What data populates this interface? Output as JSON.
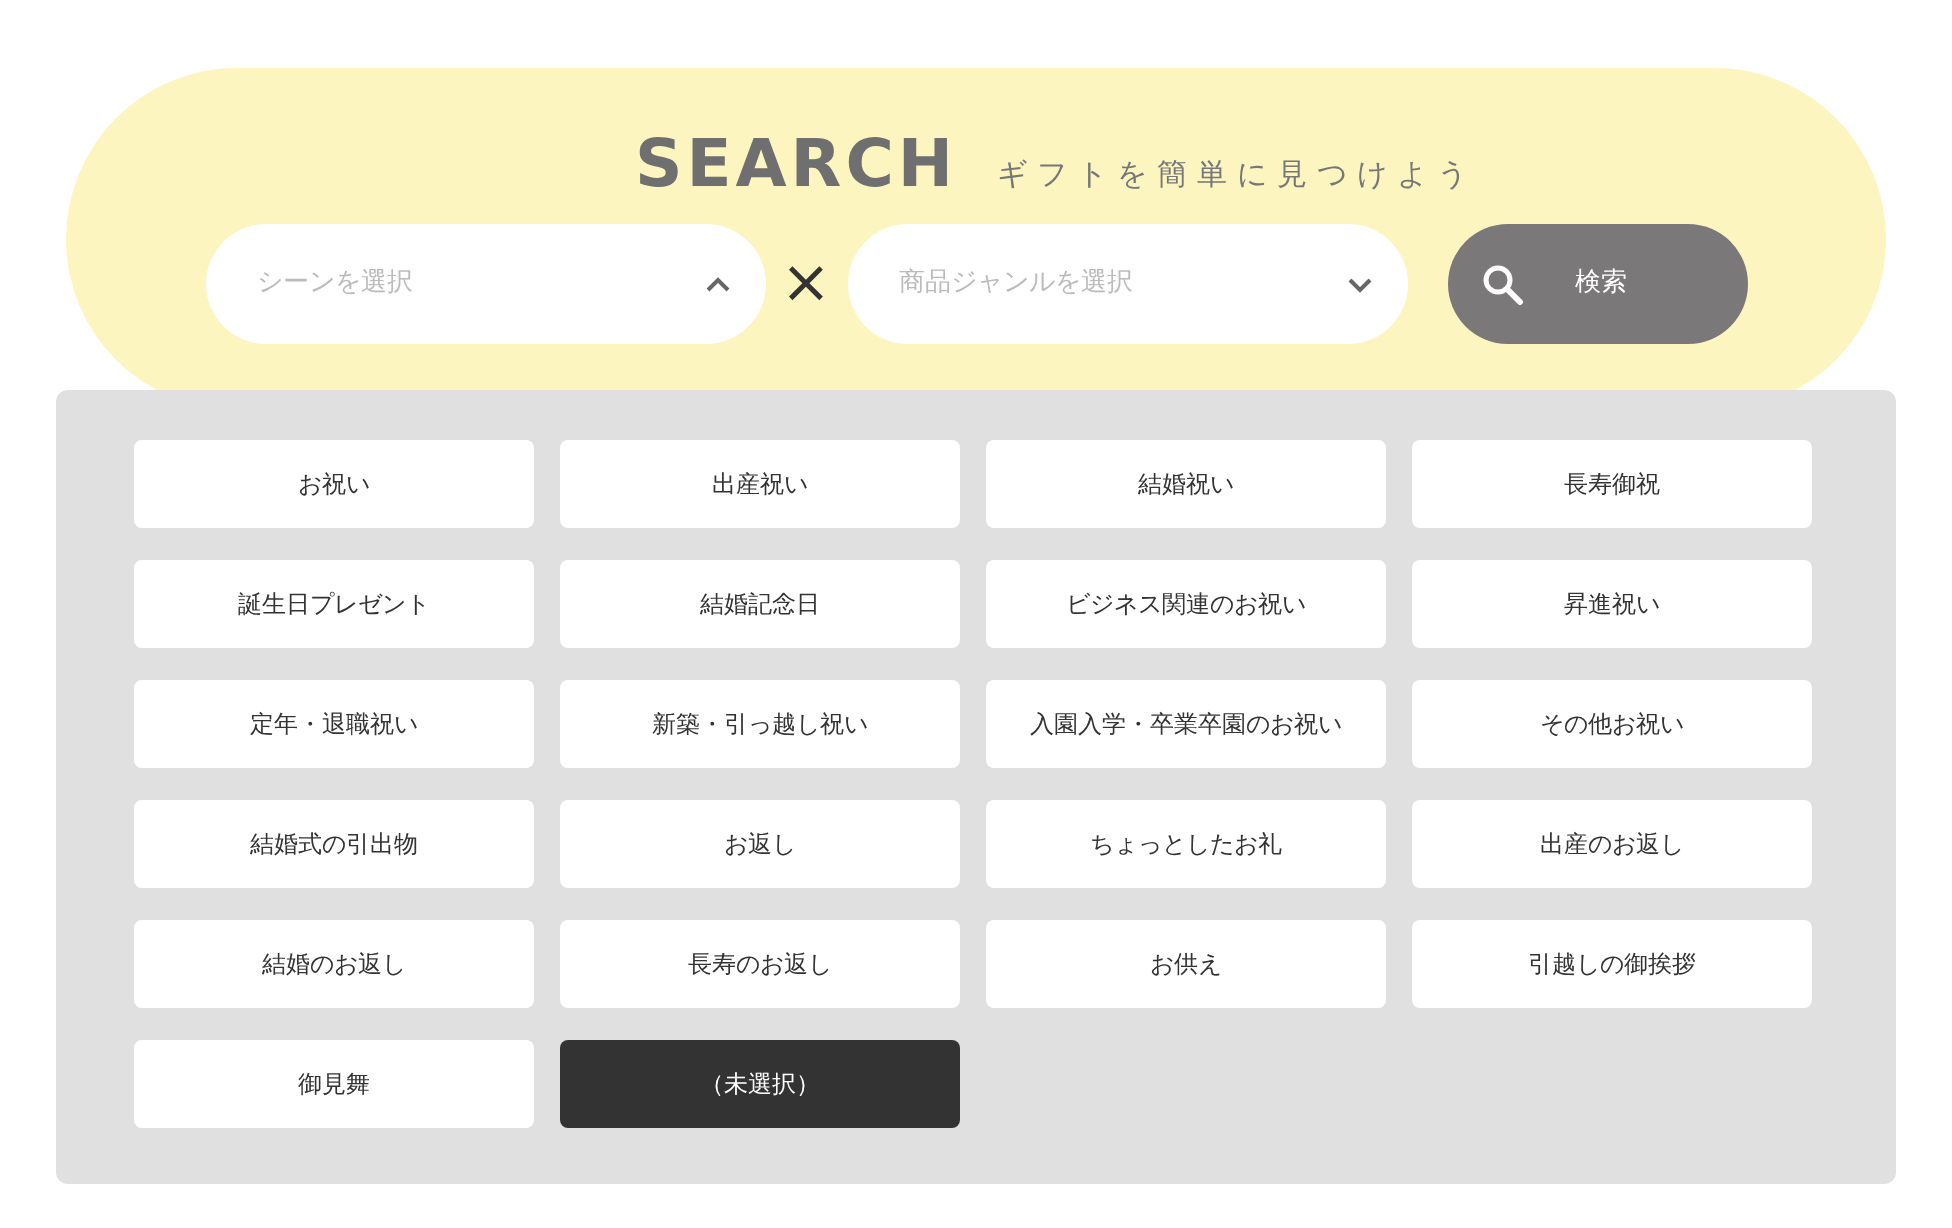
{
  "header": {
    "title": "SEARCH",
    "subtitle": "ギフトを簡単に見つけよう"
  },
  "scene_field": {
    "placeholder": "シーンを選択",
    "expanded": true
  },
  "separator": "×",
  "genre_field": {
    "placeholder": "商品ジャンルを選択",
    "expanded": false
  },
  "search_button": {
    "label": "検索"
  },
  "scene_options": [
    {
      "label": "お祝い",
      "selected": false
    },
    {
      "label": "出産祝い",
      "selected": false
    },
    {
      "label": "結婚祝い",
      "selected": false
    },
    {
      "label": "長寿御祝",
      "selected": false
    },
    {
      "label": "誕生日プレゼント",
      "selected": false
    },
    {
      "label": "結婚記念日",
      "selected": false
    },
    {
      "label": "ビジネス関連のお祝い",
      "selected": false
    },
    {
      "label": "昇進祝い",
      "selected": false
    },
    {
      "label": "定年・退職祝い",
      "selected": false
    },
    {
      "label": "新築・引っ越し祝い",
      "selected": false
    },
    {
      "label": "入園入学・卒業卒園のお祝い",
      "selected": false
    },
    {
      "label": "その他お祝い",
      "selected": false
    },
    {
      "label": "結婚式の引出物",
      "selected": false
    },
    {
      "label": "お返し",
      "selected": false
    },
    {
      "label": "ちょっとしたお礼",
      "selected": false
    },
    {
      "label": "出産のお返し",
      "selected": false
    },
    {
      "label": "結婚のお返し",
      "selected": false
    },
    {
      "label": "長寿のお返し",
      "selected": false
    },
    {
      "label": "お供え",
      "selected": false
    },
    {
      "label": "引越しの御挨拶",
      "selected": false
    },
    {
      "label": "御見舞",
      "selected": false
    },
    {
      "label": "（未選択）",
      "selected": true
    }
  ]
}
